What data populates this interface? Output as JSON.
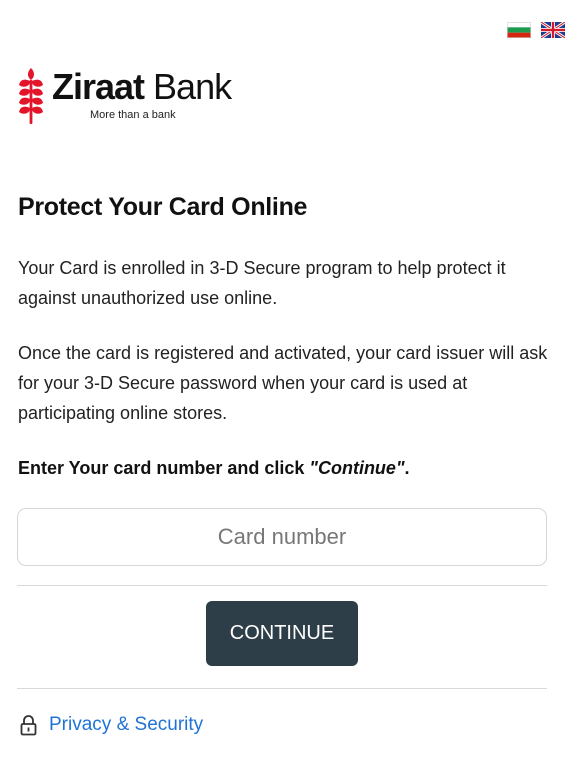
{
  "languages": [
    {
      "code": "bg",
      "icon": "bulgaria-flag-icon",
      "colors": [
        "#ffffff",
        "#1c9a4e",
        "#d62612"
      ]
    },
    {
      "code": "en",
      "icon": "uk-flag-icon",
      "colors": [
        "#1f3d8c",
        "#ffffff",
        "#cf1b2b"
      ]
    }
  ],
  "brand": {
    "name_bold": "Ziraat",
    "name_regular": " Bank",
    "tagline": "More than a bank",
    "logo_icon": "wheat-logo-icon",
    "accent_color": "#e3152b"
  },
  "main": {
    "title": "Protect Your Card Online",
    "paragraph1": "Your Card is enrolled in 3-D Secure program to help protect it against unauthorized use online.",
    "paragraph2": "Once the card is registered and activated, your card issuer will ask for your 3-D Secure password when your card is used at participating online stores.",
    "instruction_prefix": "Enter Your card number and click ",
    "instruction_emphasis": "\"Continue\"",
    "instruction_suffix": "."
  },
  "form": {
    "card_number_placeholder": "Card number",
    "card_number_value": "",
    "continue_label": "CONTINUE",
    "button_color": "#2e3e48"
  },
  "footer": {
    "privacy_label": "Privacy & Security",
    "privacy_icon": "lock-icon",
    "link_color": "#1f73d6"
  }
}
